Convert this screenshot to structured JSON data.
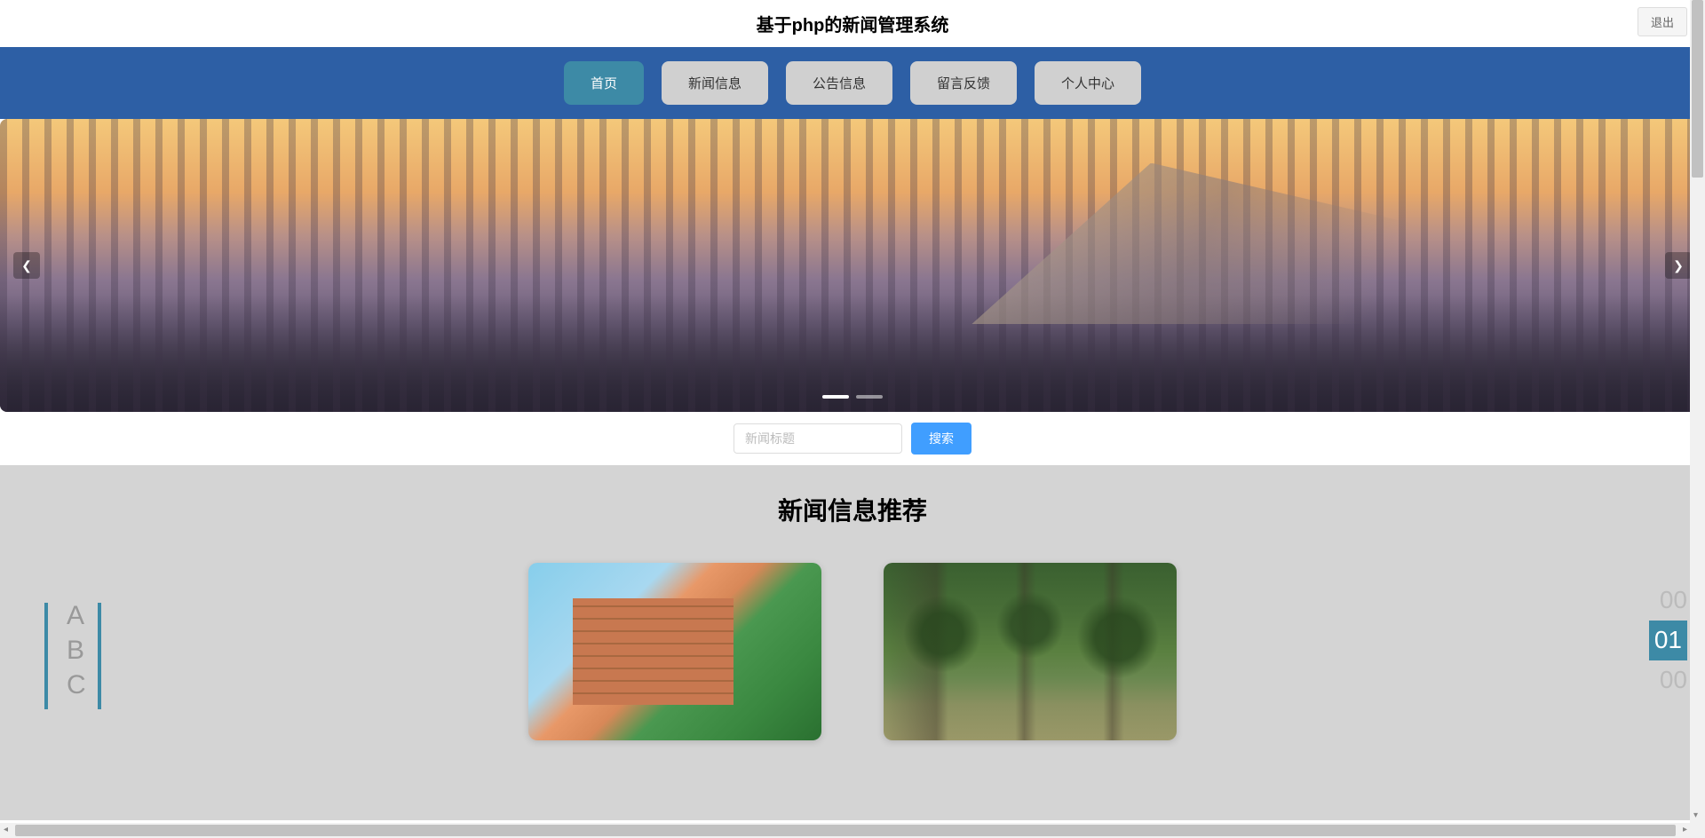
{
  "header": {
    "site_title": "基于php的新闻管理系统",
    "logout_label": "退出"
  },
  "nav": {
    "items": [
      {
        "label": "首页",
        "active": true
      },
      {
        "label": "新闻信息",
        "active": false
      },
      {
        "label": "公告信息",
        "active": false
      },
      {
        "label": "留言反馈",
        "active": false
      },
      {
        "label": "个人中心",
        "active": false
      }
    ]
  },
  "carousel": {
    "dots_count": 2,
    "active_dot": 0
  },
  "search": {
    "placeholder": "新闻标题",
    "button_label": "搜索"
  },
  "recommend": {
    "title": "新闻信息推荐",
    "side_letters": [
      "A",
      "B",
      "C"
    ],
    "side_numbers": [
      "00",
      "01",
      "00"
    ],
    "active_number_index": 1
  }
}
